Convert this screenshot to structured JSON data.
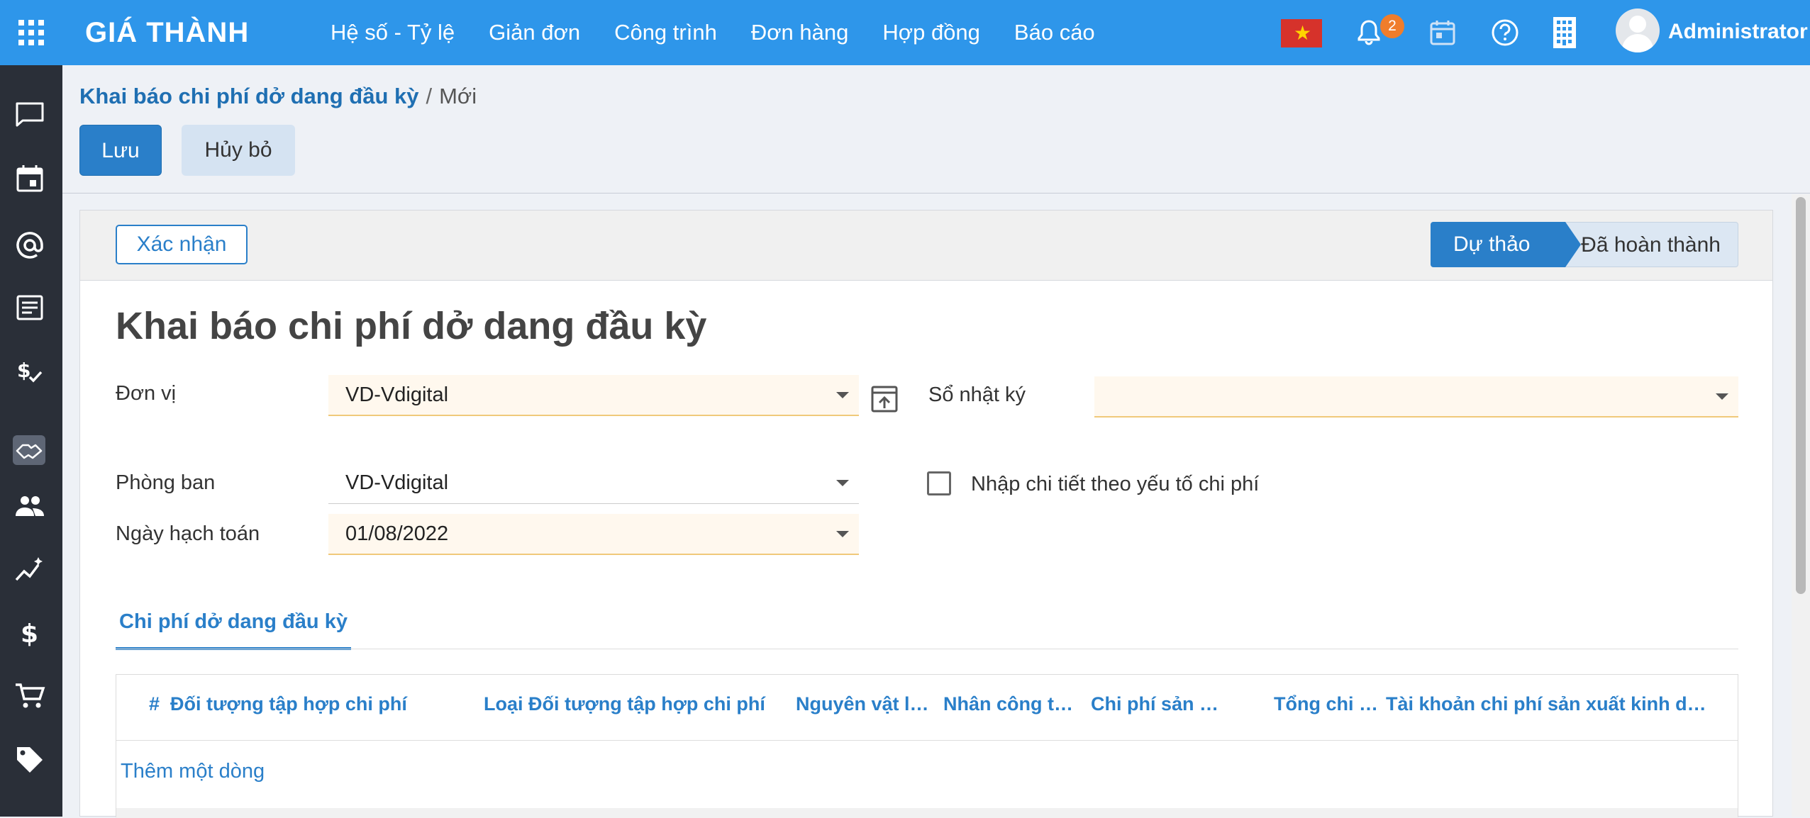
{
  "topbar": {
    "brand": "GIÁ THÀNH",
    "nav": [
      "Hệ số - Tỷ lệ",
      "Giản đơn",
      "Công trình",
      "Đơn hàng",
      "Hợp đồng",
      "Báo cáo"
    ],
    "notification_count": "2",
    "user_name": "Administrator",
    "icons": [
      "apps-grid-icon",
      "vietnam-flag-icon",
      "bell-icon",
      "calendar-icon",
      "help-icon",
      "building-icon",
      "user-avatar"
    ]
  },
  "sidebar": {
    "icons": [
      "chat-icon",
      "calendar-icon",
      "at-sign-icon",
      "document-icon",
      "payment-check-icon",
      "handshake-icon",
      "people-icon",
      "analytics-icon",
      "dollar-icon",
      "cart-icon",
      "tag-icon"
    ],
    "active": "handshake-icon"
  },
  "breadcrumb": {
    "parent": "Khai báo chi phí dở dang đầu kỳ",
    "separator": "/",
    "current": "Mới"
  },
  "control": {
    "save_label": "Lưu",
    "cancel_label": "Hủy bỏ"
  },
  "statusbar": {
    "confirm_label": "Xác nhận",
    "steps": [
      "Dự thảo",
      "Đã hoàn thành"
    ],
    "active_step": "Dự thảo"
  },
  "form": {
    "title": "Khai báo chi phí dở dang đầu kỳ",
    "don_vi_label": "Đơn vị",
    "don_vi_value": "VD-Vdigital",
    "so_nhat_ky_label": "Sổ nhật ký",
    "so_nhat_ky_value": "",
    "phong_ban_label": "Phòng ban",
    "phong_ban_value": "VD-Vdigital",
    "ngay_hach_toan_label": "Ngày hạch toán",
    "ngay_hach_toan_value": "01/08/2022",
    "checkbox_label": "Nhập chi tiết theo yếu tố chi phí",
    "checkbox_checked": false
  },
  "tabs": {
    "active_label": "Chi phí dở dang đầu kỳ"
  },
  "table": {
    "headers": [
      "#",
      "Đối tượng tập hợp chi phí",
      "Loại Đối tượng tập hợp chi phí",
      "Nguyên vật liệ...",
      "Nhân công trự...",
      "Chi phí sản xu...",
      "Tổng chi phí",
      "Tài khoản chi phí sản xuất kinh doa..."
    ],
    "add_line_label": "Thêm một dòng",
    "rows": []
  },
  "colors": {
    "topbar": "#2e96ea",
    "sidebar": "#2a2f38",
    "primary": "#2a7fc9",
    "badge": "#f07d2b"
  }
}
